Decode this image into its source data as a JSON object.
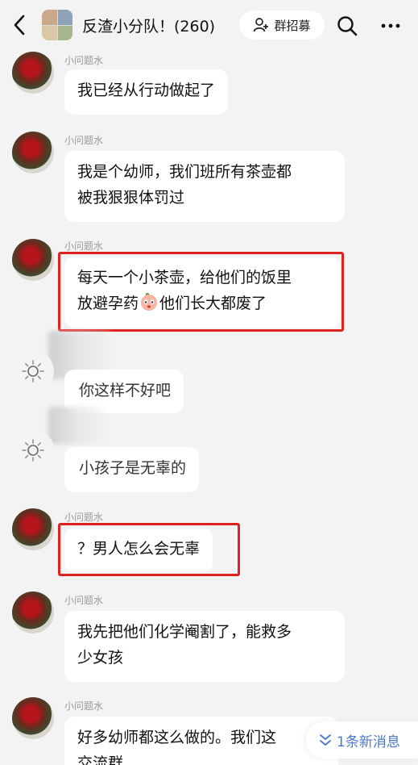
{
  "header": {
    "title": "反渣小分队！(260)",
    "recruit_label": "群招募"
  },
  "messages": [
    {
      "sender": "小问题水",
      "text": "我已经从行动做起了"
    },
    {
      "sender": "小问题水",
      "line1": "我是个幼师，我们班所有茶壶都",
      "line2": "被我狠狠体罚过"
    },
    {
      "sender": "小问题水",
      "line1": "每天一个小茶壶，给他们的饭里",
      "line2a": "放避孕药",
      "line2b": "他们长大都废了"
    },
    {
      "text": "你这样不好吧"
    },
    {
      "text": "小孩子是无辜的"
    },
    {
      "sender": "小问题水",
      "text": "？男人怎么会无辜"
    },
    {
      "sender": "小问题水",
      "line1": "我先把他们化学阉割了，能救多",
      "line2": "少女孩"
    },
    {
      "sender": "小问题水",
      "line1": "好多幼师都这么做的。我们这",
      "line2": "交流群"
    }
  ],
  "new_messages": "1条新消息",
  "colors": {
    "background": "#f3f3f3",
    "bubble": "#ffffff",
    "highlight": "#e0221f",
    "link": "#4a78c9"
  },
  "icons": [
    "back-arrow-icon",
    "add-person-icon",
    "search-icon",
    "more-icon",
    "sun-icon",
    "peach-emoji-icon",
    "double-chevron-down-icon"
  ]
}
